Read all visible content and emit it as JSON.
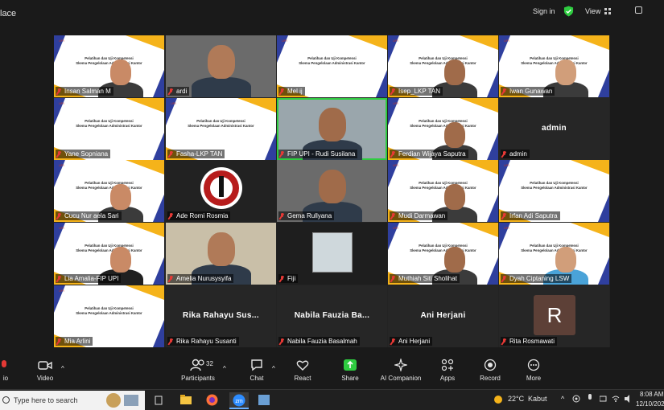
{
  "window": {
    "title": "lace",
    "signin": "Sign in",
    "view": "View"
  },
  "tiles": [
    {
      "name": "Insan Salman M",
      "kind": "slide"
    },
    {
      "name": "ardi",
      "kind": "camera"
    },
    {
      "name": "Mel ij",
      "kind": "slide"
    },
    {
      "name": "Isep_LKP TAN",
      "kind": "slide"
    },
    {
      "name": "Iwan Gunawan",
      "kind": "slide"
    },
    {
      "name": "Yane Sopniana",
      "kind": "slide"
    },
    {
      "name": "Fasha-LKP TAN",
      "kind": "slide"
    },
    {
      "name": "FIP UPI - Rudi Susilana",
      "kind": "camera"
    },
    {
      "name": "Ferdian Wijaya Saputra",
      "kind": "slide"
    },
    {
      "name": "admin",
      "kind": "dark",
      "center": "admin"
    },
    {
      "name": "Cucu Nur aela Sari",
      "kind": "slide"
    },
    {
      "name": "Ade Romi Rosmia",
      "kind": "logo"
    },
    {
      "name": "Gema Rullyana",
      "kind": "camera"
    },
    {
      "name": "Mudi Darmawan",
      "kind": "slide"
    },
    {
      "name": "Irfan Adi Saputra",
      "kind": "slide"
    },
    {
      "name": "Lia Amalia-FIP UPI",
      "kind": "slide"
    },
    {
      "name": "Amelia Nurusysyifa",
      "kind": "camera"
    },
    {
      "name": "Fiji",
      "kind": "photo"
    },
    {
      "name": "Muthiah Siti Sholihat",
      "kind": "slide"
    },
    {
      "name": "Dyah Ciptaning LSW",
      "kind": "slide"
    },
    {
      "name": "Mia Arlini",
      "kind": "slide"
    },
    {
      "name": "Rika Rahayu Susanti",
      "kind": "dark",
      "center": "Rika  Rahayu  Sus..."
    },
    {
      "name": "Nabila Fauzia Basalmah",
      "kind": "dark",
      "center": "Nabila  Fauzia  Ba..."
    },
    {
      "name": "Ani Herjani",
      "kind": "dark",
      "center": "Ani Herjani"
    },
    {
      "name": "Rita Rosmawati",
      "kind": "dark",
      "avatar": "R"
    }
  ],
  "slide": {
    "line1": "Pelatihan dan Uji Kompetensi",
    "line2": "Skema Pengelolaan Administrasi Kantor",
    "logos": "UPI"
  },
  "toolbar": {
    "audio": "io",
    "video": "Video",
    "participants": "Participants",
    "participant_count": "32",
    "chat": "Chat",
    "react": "React",
    "share": "Share",
    "ai": "AI Companion",
    "apps": "Apps",
    "record": "Record",
    "more": "More"
  },
  "taskbar": {
    "search_placeholder": "Type here to search",
    "temp": "22°C",
    "weather": "Kabut",
    "time": "8:08 AM",
    "date": "12/10/202"
  },
  "colors": {
    "active_speaker": "#2ecc40",
    "slide_blue": "#2f3f9e",
    "slide_yellow": "#f5b31a",
    "muted_mic": "#e53935"
  }
}
